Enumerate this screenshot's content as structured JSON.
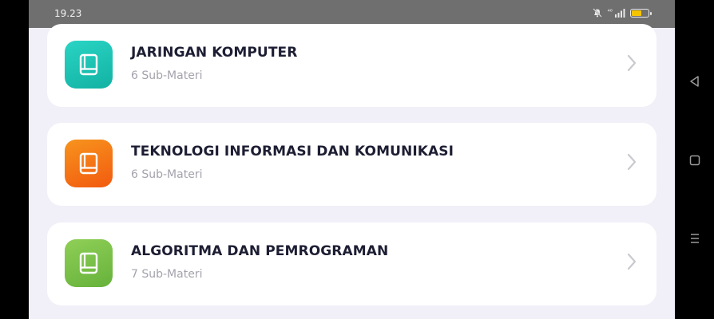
{
  "status_bar": {
    "time": "19.23",
    "network_label": "⁴⁶",
    "battery_level": 0.6
  },
  "colors": {
    "teal": "#1bbfb0",
    "orange": "#f56d12",
    "green": "#78c04a",
    "background": "#f1f0f8",
    "title": "#1d1e33",
    "subtitle": "#a3a3ad"
  },
  "courses": [
    {
      "title": "JARINGAN KOMPUTER",
      "subtitle": "6 Sub-Materi",
      "icon": "book-icon",
      "color": "teal"
    },
    {
      "title": "TEKNOLOGI INFORMASI DAN KOMUNIKASI",
      "subtitle": "6 Sub-Materi",
      "icon": "book-icon",
      "color": "orange"
    },
    {
      "title": "ALGORITMA DAN PEMROGRAMAN",
      "subtitle": "7 Sub-Materi",
      "icon": "book-icon",
      "color": "green"
    }
  ],
  "nav": {
    "back": "back-triangle-icon",
    "home": "home-square-icon",
    "menu": "menu-lines-icon"
  }
}
